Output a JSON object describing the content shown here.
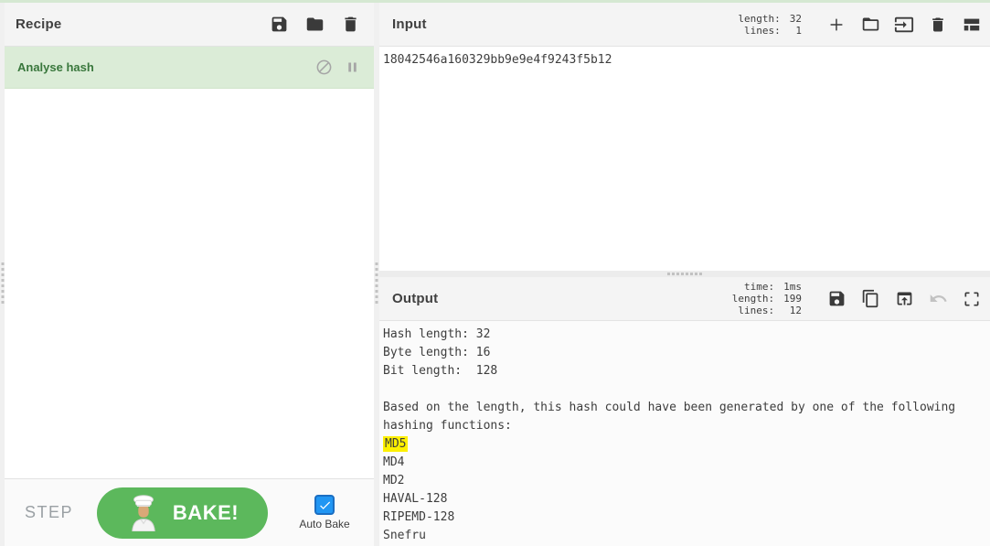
{
  "colors": {
    "accent_green": "#5cb85c",
    "operation_bg": "#dbecd7",
    "operation_text": "#39773c",
    "highlight_yellow": "#fdf000",
    "checkbox_blue": "#2196f3",
    "header_bg": "#f4f4f4"
  },
  "recipe": {
    "title": "Recipe",
    "operations": [
      {
        "name": "Analyse hash",
        "disabled": false,
        "breakpoint": false
      }
    ],
    "controls": {
      "step_label": "STEP",
      "bake_label": "BAKE!",
      "auto_bake_label": "Auto Bake",
      "auto_bake_checked": true
    }
  },
  "input": {
    "title": "Input",
    "stats": {
      "length_label": "length:",
      "length_value": "32",
      "lines_label": "lines:",
      "lines_value": "1"
    },
    "value": "18042546a160329bb9e9e4f9243f5b12"
  },
  "output": {
    "title": "Output",
    "stats": {
      "time_label": "time:",
      "time_value": "1ms",
      "length_label": "length:",
      "length_value": "199",
      "lines_label": "lines:",
      "lines_value": "12"
    },
    "lines": [
      "Hash length: 32",
      "Byte length: 16",
      "Bit length:  128",
      "",
      "Based on the length, this hash could have been generated by one of the following",
      "hashing functions:",
      "MD5",
      "MD4",
      "MD2",
      "HAVAL-128",
      "RIPEMD-128",
      "Snefru"
    ],
    "highlighted_line": "MD5"
  }
}
